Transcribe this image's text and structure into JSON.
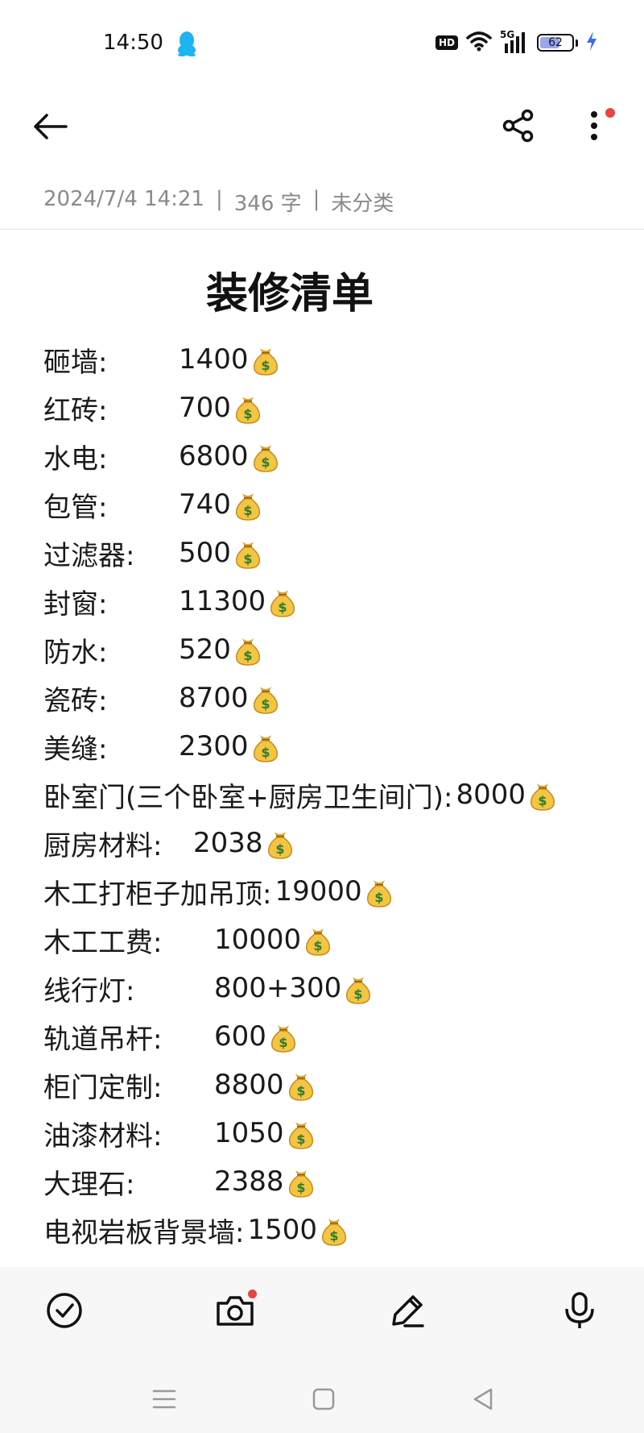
{
  "status_bar": {
    "time": "14:50",
    "network": "5G",
    "hd": "HD",
    "battery": "62",
    "battery_level": 0.62,
    "icons": [
      "qq-icon",
      "hd-icon",
      "wifi-icon",
      "signal-icon",
      "battery-icon",
      "charging-icon"
    ]
  },
  "toolbar": {
    "icons": [
      "back-arrow-icon",
      "share-icon",
      "more-vertical-icon"
    ]
  },
  "meta": {
    "datetime": "2024/7/4 14:21",
    "separator": "|",
    "word_count": "346 字",
    "category": "未分类"
  },
  "note": {
    "title": "装修清单",
    "items": [
      {
        "label": "砸墙:",
        "value": "1400"
      },
      {
        "label": "红砖:",
        "value": "700"
      },
      {
        "label": "水电:",
        "value": "6800"
      },
      {
        "label": "包管:",
        "value": "740"
      },
      {
        "label": "过滤器:",
        "value": "500"
      },
      {
        "label": "封窗:",
        "value": "11300"
      },
      {
        "label": "防水:",
        "value": "520"
      },
      {
        "label": "瓷砖:",
        "value": "8700"
      },
      {
        "label": "美缝:",
        "value": "2300"
      },
      {
        "label": "卧室门(三个卧室+厨房卫生间门):",
        "value": "8000"
      },
      {
        "label": "厨房材料:",
        "value": "2038"
      },
      {
        "label": "木工打柜子加吊顶:",
        "value": "19000"
      },
      {
        "label": "木工工费:",
        "value": "10000"
      },
      {
        "label": "线行灯:",
        "value": "800+300"
      },
      {
        "label": "轨道吊杆:",
        "value": "600"
      },
      {
        "label": "柜门定制:",
        "value": "8800"
      },
      {
        "label": "油漆材料:",
        "value": "1050"
      },
      {
        "label": "大理石:",
        "value": "2388"
      },
      {
        "label": "电视岩板背景墙:",
        "value": "1500"
      }
    ],
    "item_icon": "money-bag-icon"
  },
  "bottom_bar": {
    "icons": [
      "checklist-icon",
      "camera-icon",
      "pen-icon",
      "microphone-icon"
    ]
  },
  "nav_bar": {
    "icons": [
      "menu-icon",
      "home-icon",
      "back-icon"
    ]
  },
  "colors": {
    "text": "#1a1a1a",
    "meta_text": "#8a8a8a",
    "badge_red": "#e8453c",
    "bottom_bg": "#f7f7f7",
    "charging": "#3b6df0"
  }
}
